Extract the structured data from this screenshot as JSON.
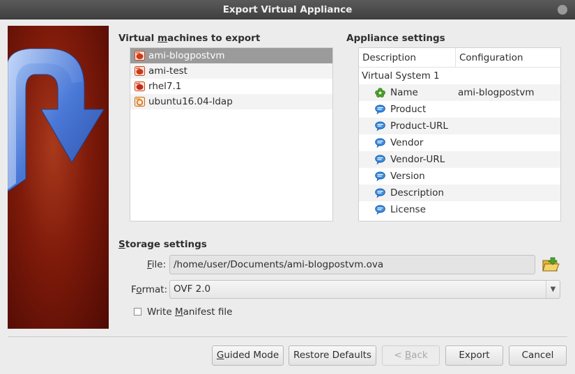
{
  "window": {
    "title": "Export Virtual Appliance"
  },
  "vm_section": {
    "title_pre": "Virtual ",
    "title_u": "m",
    "title_post": "achines to export",
    "items": [
      {
        "name": "ami-blogpostvm",
        "selected": true
      },
      {
        "name": "ami-test",
        "selected": false
      },
      {
        "name": "rhel7.1",
        "selected": false
      },
      {
        "name": "ubuntu16.04-ldap",
        "selected": false
      }
    ]
  },
  "appliance_settings": {
    "title": "Appliance settings",
    "columns": [
      "Description",
      "Configuration"
    ],
    "group": "Virtual System 1",
    "rows": [
      {
        "description": "Name",
        "configuration": "ami-blogpostvm",
        "icon": "name-icon"
      },
      {
        "description": "Product",
        "configuration": "",
        "icon": "comment-icon"
      },
      {
        "description": "Product-URL",
        "configuration": "",
        "icon": "comment-icon"
      },
      {
        "description": "Vendor",
        "configuration": "",
        "icon": "comment-icon"
      },
      {
        "description": "Vendor-URL",
        "configuration": "",
        "icon": "comment-icon"
      },
      {
        "description": "Version",
        "configuration": "",
        "icon": "comment-icon"
      },
      {
        "description": "Description",
        "configuration": "",
        "icon": "comment-icon"
      },
      {
        "description": "License",
        "configuration": "",
        "icon": "comment-icon"
      }
    ]
  },
  "storage": {
    "title_u": "S",
    "title_post": "torage settings",
    "file_label_u": "F",
    "file_label_post": "ile:",
    "file_value": "/home/user/Documents/ami-blogpostvm.ova",
    "format_label_pre": "F",
    "format_label_u": "o",
    "format_label_post": "rmat:",
    "format_value": "OVF 2.0",
    "manifest_pre": "Write ",
    "manifest_u": "M",
    "manifest_post": "anifest file",
    "manifest_checked": false
  },
  "buttons": {
    "guided_u": "G",
    "guided_post": "uided Mode",
    "restore": "Restore Defaults",
    "back_pre": "< ",
    "back_u": "B",
    "back_post": "ack",
    "export": "Export",
    "cancel": "Cancel"
  },
  "colors": {
    "selection": "#9b9b9b",
    "titlebar": "#444444",
    "banner": "#7e1a0a",
    "arrow": "#4a78d6"
  }
}
